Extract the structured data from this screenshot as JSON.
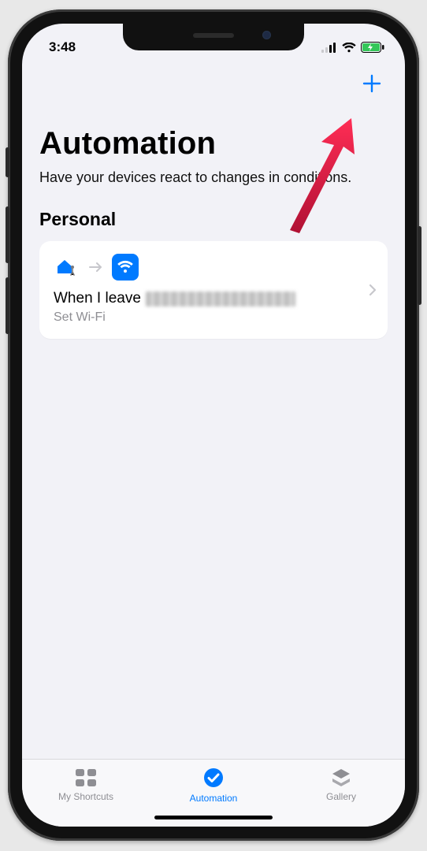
{
  "status": {
    "time": "3:48"
  },
  "header": {
    "title": "Automation",
    "subtitle": "Have your devices react to changes in conditions."
  },
  "section": {
    "head": "Personal"
  },
  "automation": {
    "title_prefix": "When I leave",
    "subtitle": "Set Wi-Fi"
  },
  "tabs": {
    "shortcuts": "My Shortcuts",
    "automation": "Automation",
    "gallery": "Gallery"
  },
  "colors": {
    "accent": "#007aff"
  }
}
